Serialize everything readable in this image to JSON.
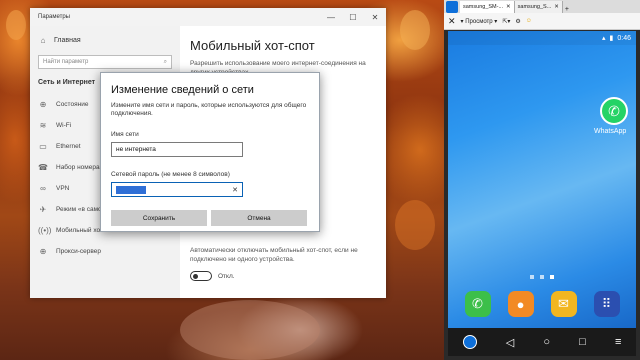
{
  "settings": {
    "title": "Параметры",
    "home_label": "Главная",
    "search_placeholder": "Найти параметр",
    "section_label": "Сеть и Интернет",
    "items": [
      {
        "label": "Состояние",
        "icon": "status-icon",
        "glyph": "⊕"
      },
      {
        "label": "Wi-Fi",
        "icon": "wifi-icon",
        "glyph": "≋"
      },
      {
        "label": "Ethernet",
        "icon": "ethernet-icon",
        "glyph": "▭"
      },
      {
        "label": "Набор номера",
        "icon": "dialup-icon",
        "glyph": "☎"
      },
      {
        "label": "VPN",
        "icon": "vpn-icon",
        "glyph": "∞"
      },
      {
        "label": "Режим «в само...",
        "icon": "airplane-icon",
        "glyph": "✈"
      },
      {
        "label": "Мобильный хот-спот",
        "icon": "hotspot-icon",
        "glyph": "((•))"
      },
      {
        "label": "Прокси-сервер",
        "icon": "globe-icon",
        "glyph": "⊕"
      }
    ],
    "page_title": "Мобильный хот-спот",
    "page_desc": "Разрешить использование моего интернет-соединения на других устройствах",
    "auto_off_text": "Автоматически отключать мобильный хот-спот, если не подключено ни одного устройства.",
    "toggle_label": "Откл."
  },
  "dialog": {
    "title": "Изменение сведений о сети",
    "desc": "Измените имя сети и пароль, которые используются для общего подключения.",
    "name_label": "Имя сети",
    "name_value": "не интернета",
    "pass_label": "Сетевой пароль (не менее 8 символов)",
    "pass_clear": "✕",
    "save_label": "Сохранить",
    "cancel_label": "Отмена"
  },
  "phone": {
    "tabs": [
      "samsung_SM-...",
      "samsung_S..."
    ],
    "toolbar_view": "Просмотр",
    "time": "0:46",
    "whatsapp_label": "WhatsApp"
  }
}
